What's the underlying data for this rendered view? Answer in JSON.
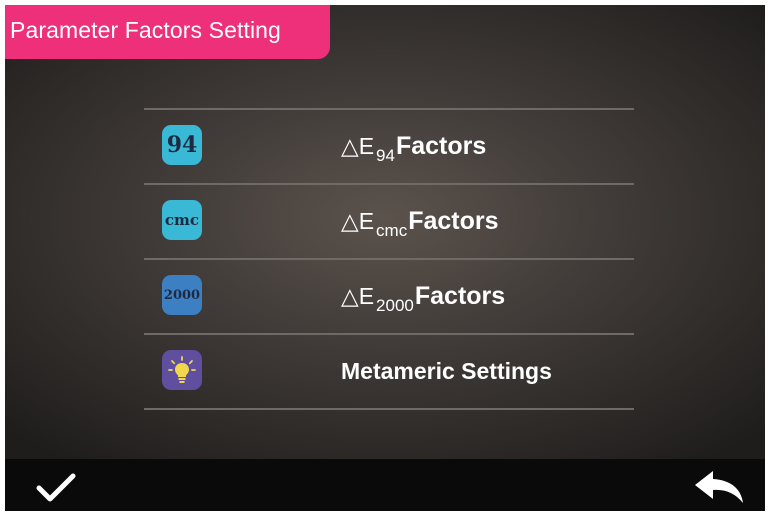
{
  "title": "Parameter Factors Setting",
  "menu": [
    {
      "icon_text": "94",
      "icon_color": "#39b9d6",
      "prefix": "△E",
      "sub": "94",
      "label": "Factors"
    },
    {
      "icon_text": "cmc",
      "icon_color": "#39b9d6",
      "prefix": "△E",
      "sub": "cmc",
      "label": "Factors"
    },
    {
      "icon_text": "2000",
      "icon_color": "#3c7fc3",
      "prefix": "△E",
      "sub": "2000",
      "label": "Factors"
    },
    {
      "icon_text": "",
      "icon_color": "#5f4f9e",
      "label": "Metameric Settings",
      "icon": "lightbulb-icon"
    }
  ],
  "bottom": {
    "confirm_icon": "checkmark-icon",
    "back_icon": "back-arrow-icon"
  },
  "colors": {
    "accent": "#ee2f7a",
    "bar": "#0a0a0a"
  }
}
